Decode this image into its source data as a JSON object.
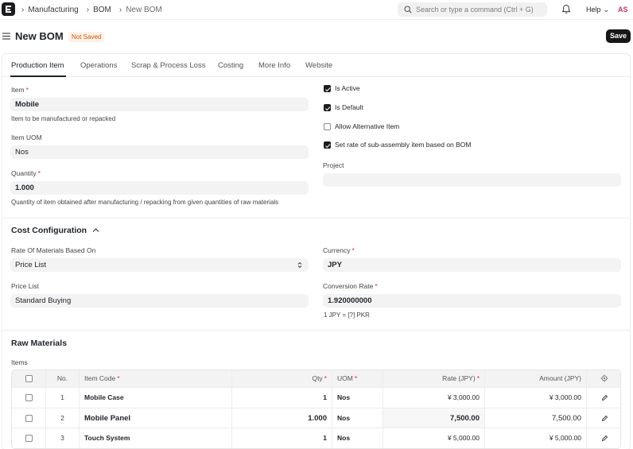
{
  "navbar": {
    "breadcrumbs": [
      "Manufacturing",
      "BOM",
      "New BOM"
    ],
    "search_placeholder": "Search or type a command (Ctrl + G)",
    "help_label": "Help",
    "avatar_initials": "AS"
  },
  "page": {
    "title": "New BOM",
    "status_badge": "Not Saved",
    "save_label": "Save"
  },
  "tabs": [
    "Production Item",
    "Operations",
    "Scrap & Process Loss",
    "Costing",
    "More Info",
    "Website"
  ],
  "production": {
    "item_label": "Item",
    "item_value": "Mobile",
    "item_desc": "Item to be manufactured or repacked",
    "uom_label": "Item UOM",
    "uom_value": "Nos",
    "qty_label": "Quantity",
    "qty_value": "1.000",
    "qty_desc": "Quantity of item obtained after manufacturing / repacking from given quantities of raw materials",
    "project_label": "Project",
    "checks": [
      {
        "label": "Is Active",
        "checked": true
      },
      {
        "label": "Is Default",
        "checked": true
      },
      {
        "label": "Allow Alternative Item",
        "checked": false
      },
      {
        "label": "Set rate of sub-assembly item based on BOM",
        "checked": true
      }
    ]
  },
  "cost": {
    "title": "Cost Configuration",
    "rate_label": "Rate Of Materials Based On",
    "rate_value": "Price List",
    "price_list_label": "Price List",
    "price_list_value": "Standard Buying",
    "currency_label": "Currency",
    "currency_value": "JPY",
    "conv_label": "Conversion Rate",
    "conv_value": "1.920000000",
    "conv_desc": "1 JPY = [?] PKR"
  },
  "raw": {
    "title": "Raw Materials",
    "items_label": "Items",
    "columns": {
      "no": "No.",
      "item_code": "Item Code",
      "qty": "Qty",
      "uom": "UOM",
      "rate": "Rate (JPY)",
      "amount": "Amount (JPY)"
    },
    "rows": [
      {
        "no": "1",
        "item_code": "Mobile Case",
        "qty": "1",
        "uom": "Nos",
        "rate": "¥ 3,000.00",
        "amount": "¥ 3,000.00"
      },
      {
        "no": "2",
        "item_code": "Mobile Panel",
        "qty": "1.000",
        "uom": "Nos",
        "rate": "7,500.00",
        "amount": "7,500.00"
      },
      {
        "no": "3",
        "item_code": "Touch System",
        "qty": "1",
        "uom": "Nos",
        "rate": "¥ 5,000.00",
        "amount": "¥ 5,000.00"
      }
    ]
  },
  "icons": {
    "search": "search-icon",
    "bell": "bell-icon",
    "menu": "hamburger-icon",
    "settings": "settings-icon",
    "edit": "edit-icon"
  }
}
